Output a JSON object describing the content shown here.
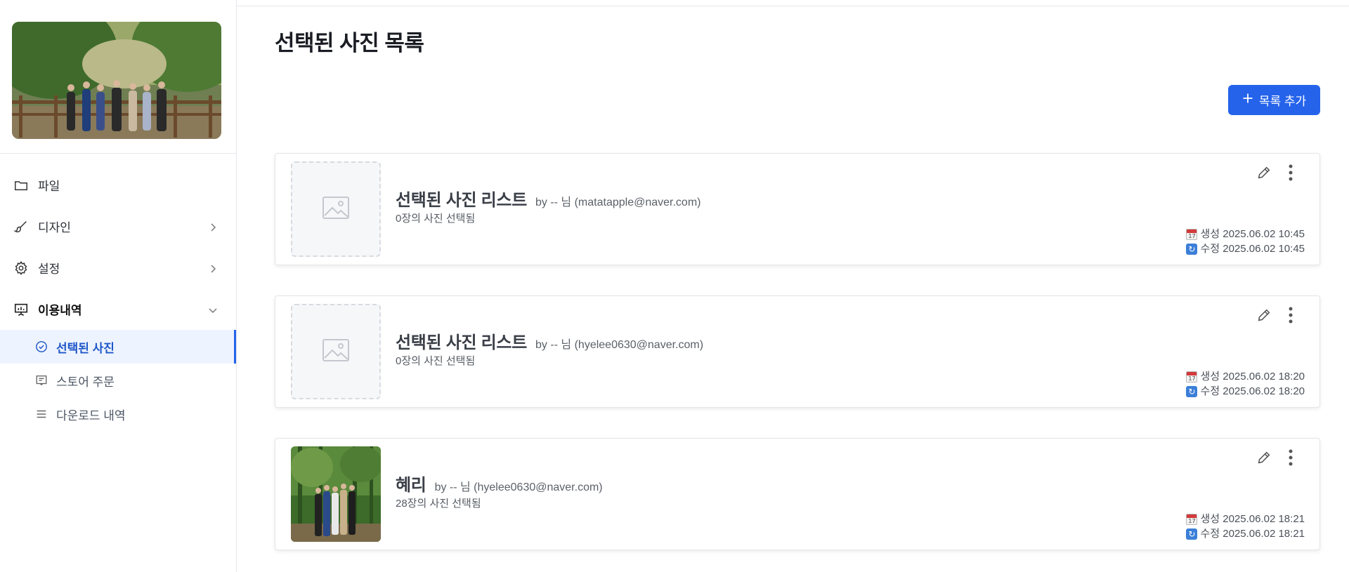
{
  "sidebar": {
    "nav": [
      {
        "label": "파일",
        "icon": "folder-icon"
      },
      {
        "label": "디자인",
        "icon": "brush-icon"
      },
      {
        "label": "설정",
        "icon": "gear-icon"
      },
      {
        "label": "이용내역",
        "icon": "presentation-icon"
      }
    ],
    "sub": [
      {
        "label": "선택된 사진",
        "icon": "check-circle-icon",
        "active": true
      },
      {
        "label": "스토어 주문",
        "icon": "receipt-icon"
      },
      {
        "label": "다운로드 내역",
        "icon": "list-icon"
      }
    ]
  },
  "main": {
    "title": "선택된 사진 목록",
    "add_button": "목록 추가",
    "cards": [
      {
        "name": "선택된 사진 리스트",
        "by": "by -- 님 (matatapple@naver.com)",
        "count": "0장의 사진 선택됨",
        "created": "생성 2025.06.02 10:45",
        "updated": "수정 2025.06.02 10:45",
        "thumbnail": "placeholder"
      },
      {
        "name": "선택된 사진 리스트",
        "by": "by -- 님 (hyelee0630@naver.com)",
        "count": "0장의 사진 선택됨",
        "created": "생성 2025.06.02 18:20",
        "updated": "수정 2025.06.02 18:20",
        "thumbnail": "placeholder"
      },
      {
        "name": "혜리",
        "by": "by -- 님 (hyelee0630@naver.com)",
        "count": "28장의 사진 선택됨",
        "created": "생성 2025.06.02 18:21",
        "updated": "수정 2025.06.02 18:21",
        "thumbnail": "photo"
      }
    ]
  },
  "colors": {
    "accent": "#2563eb",
    "active_bg": "#eef4ff"
  }
}
